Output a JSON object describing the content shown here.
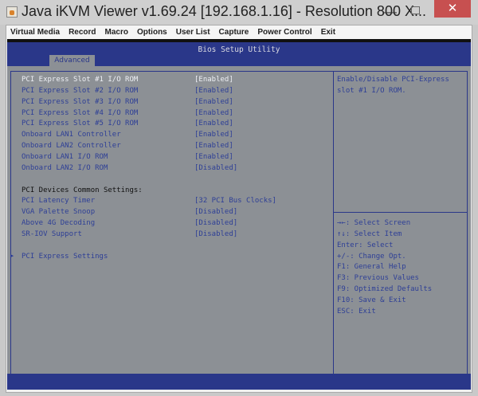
{
  "window": {
    "title": "Java iKVM Viewer v1.69.24 [192.168.1.16]  - Resolution 800 X...",
    "minimize": "—",
    "close": "✕"
  },
  "menu": [
    "Virtual Media",
    "Record",
    "Macro",
    "Options",
    "User List",
    "Capture",
    "Power Control",
    "Exit"
  ],
  "bios": {
    "title": "Bios Setup Utility",
    "tab": "Advanced",
    "items": [
      {
        "label": "PCI Express Slot #1 I/O ROM",
        "value": "[Enabled]"
      },
      {
        "label": "PCI Express Slot #2 I/O ROM",
        "value": "[Enabled]"
      },
      {
        "label": "PCI Express Slot #3 I/O ROM",
        "value": "[Enabled]"
      },
      {
        "label": "PCI Express Slot #4 I/O ROM",
        "value": "[Enabled]"
      },
      {
        "label": "PCI Express Slot #5 I/O ROM",
        "value": "[Enabled]"
      },
      {
        "label": "Onboard LAN1 Controller",
        "value": "[Enabled]"
      },
      {
        "label": "Onboard LAN2 Controller",
        "value": "[Enabled]"
      },
      {
        "label": "Onboard LAN1 I/O ROM",
        "value": "[Enabled]"
      },
      {
        "label": "Onboard LAN2 I/O ROM",
        "value": "[Disabled]"
      }
    ],
    "section": "PCI Devices Common Settings:",
    "common": [
      {
        "label": "PCI Latency Timer",
        "value": "[32 PCI Bus Clocks]"
      },
      {
        "label": "VGA Palette Snoop",
        "value": "[Disabled]"
      },
      {
        "label": "Above 4G Decoding",
        "value": "[Disabled]"
      },
      {
        "label": "SR-IOV Support",
        "value": "[Disabled]"
      }
    ],
    "submenu": "PCI Express Settings",
    "submenu_arrow": "▶",
    "help": [
      "Enable/Disable PCI-Express",
      "slot #1 I/O ROM."
    ],
    "keys": [
      "→←: Select Screen",
      "↑↓: Select Item",
      "Enter: Select",
      "+/-: Change Opt.",
      "F1: General Help",
      "F3: Previous Values",
      "F9: Optimized Defaults",
      "F10: Save & Exit",
      "ESC: Exit"
    ]
  }
}
